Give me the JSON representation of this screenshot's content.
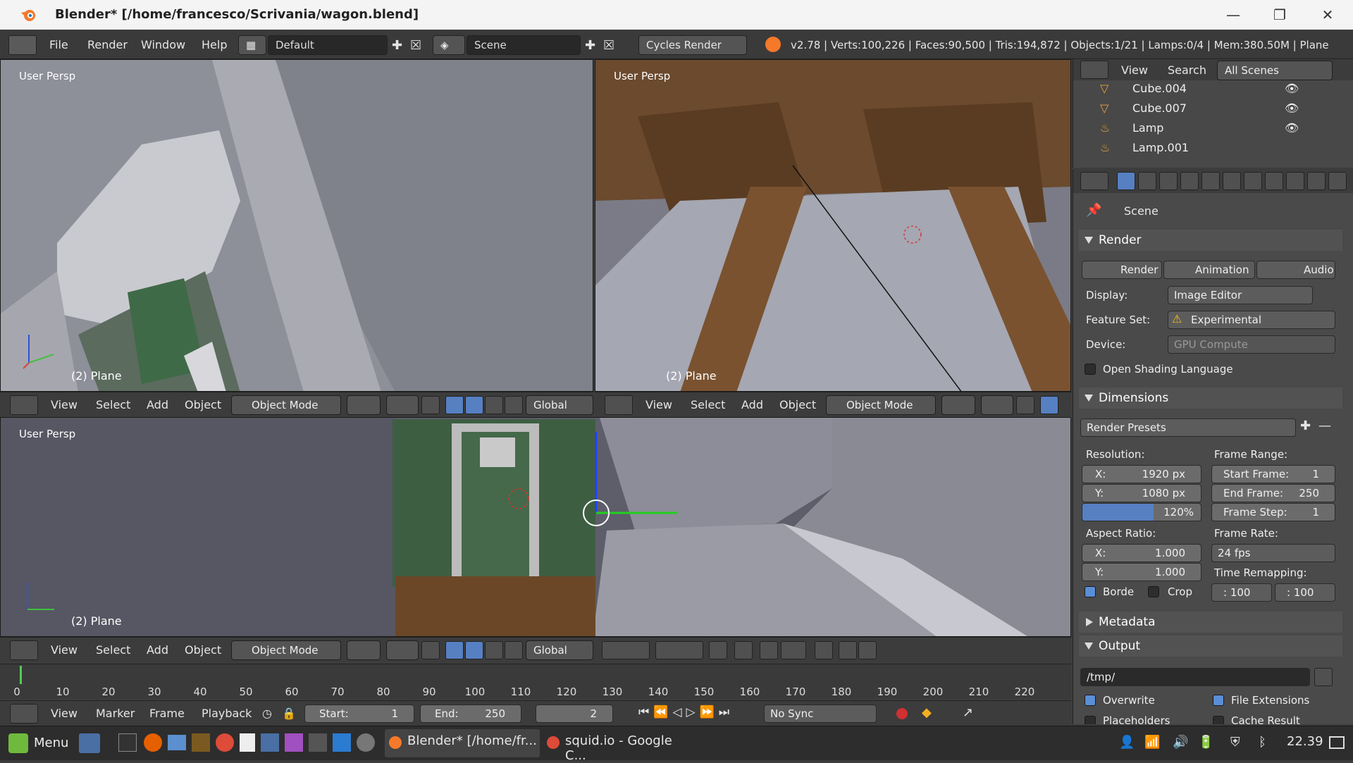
{
  "window": {
    "title": "Blender* [/home/francesco/Scrivania/wagon.blend]",
    "icons": [
      "blender-logo-icon",
      "minimize-icon",
      "maximize-icon",
      "close-icon"
    ]
  },
  "infobar": {
    "menus": [
      "File",
      "Render",
      "Window",
      "Help"
    ],
    "layout": "Default",
    "scene": "Scene",
    "engine": "Cycles Render",
    "stats": "v2.78 | Verts:100,226 | Faces:90,500 | Tris:194,872 | Objects:1/21 | Lamps:0/4 | Mem:380.50M | Plane"
  },
  "viewports": [
    {
      "label": "User Persp",
      "object": "(2) Plane"
    },
    {
      "label": "User Persp",
      "object": "(2) Plane"
    },
    {
      "label": "User Persp",
      "object": "(2) Plane"
    }
  ],
  "viewport_header": {
    "menus": [
      "View",
      "Select",
      "Add",
      "Object"
    ],
    "mode": "Object Mode",
    "orientation": "Global"
  },
  "outliner": {
    "menus": [
      "View",
      "Search"
    ],
    "filter": "All Scenes",
    "items": [
      "Cube.004",
      "Cube.007",
      "Lamp",
      "Lamp.001"
    ]
  },
  "properties": {
    "scene_label": "Scene",
    "render_panel": "Render",
    "render_buttons": [
      "Render",
      "Animation",
      "Audio"
    ],
    "display_label": "Display:",
    "display_value": "Image Editor",
    "feature_label": "Feature Set:",
    "feature_value": "Experimental",
    "device_label": "Device:",
    "device_value": "GPU Compute",
    "osl_label": "Open Shading Language",
    "dimensions_panel": "Dimensions",
    "presets": "Render Presets",
    "resolution_label": "Resolution:",
    "res_x_label": "X:",
    "res_x": "1920 px",
    "res_y_label": "Y:",
    "res_y": "1080 px",
    "res_pct": "120%",
    "res_pct_fraction": 0.6,
    "frame_range_label": "Frame Range:",
    "start_label": "Start Frame:",
    "start": "1",
    "end_label": "End Frame:",
    "end": "250",
    "step_label": "Frame Step:",
    "step": "1",
    "aspect_label": "Aspect Ratio:",
    "asp_x_label": "X:",
    "asp_x": "1.000",
    "asp_y_label": "Y:",
    "asp_y": "1.000",
    "framerate_label": "Frame Rate:",
    "framerate": "24 fps",
    "remap_label": "Time Remapping:",
    "remap_old": ": 100",
    "remap_new": ": 100",
    "border_label": "Borde",
    "crop_label": "Crop",
    "metadata_panel": "Metadata",
    "output_panel": "Output",
    "output_path": "/tmp/",
    "overwrite_label": "Overwrite",
    "file_ext_label": "File Extensions",
    "placeholders_label": "Placeholders",
    "cache_label": "Cache Result"
  },
  "timeline": {
    "ticks": [
      "0",
      "10",
      "20",
      "30",
      "40",
      "50",
      "60",
      "70",
      "80",
      "90",
      "100",
      "110",
      "120",
      "130",
      "140",
      "150",
      "160",
      "170",
      "180",
      "190",
      "200",
      "210",
      "220"
    ],
    "menus": [
      "View",
      "Marker",
      "Frame",
      "Playback"
    ],
    "start_label": "Start:",
    "start": "1",
    "end_label": "End:",
    "end": "250",
    "current": "2",
    "sync": "No Sync"
  },
  "taskbar": {
    "menu": "Menu",
    "task1": "Blender* [/home/fr...",
    "task2": "squid.io - Google C...",
    "clock": "22.39"
  }
}
